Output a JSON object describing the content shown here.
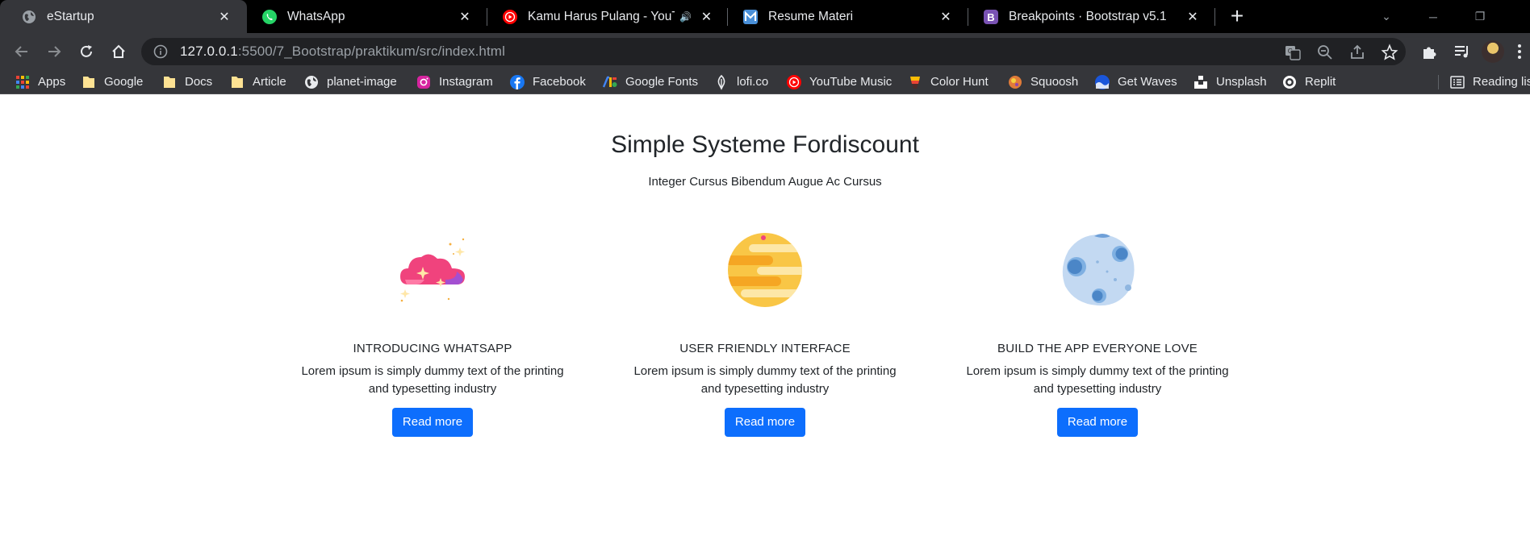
{
  "tabs": [
    {
      "title": "eStartup",
      "icon": "globe-icon",
      "active": true
    },
    {
      "title": "WhatsApp",
      "icon": "whatsapp-icon",
      "active": false
    },
    {
      "title": "Kamu Harus Pulang - YouTube",
      "icon": "youtube-icon",
      "active": false,
      "audio": true
    },
    {
      "title": "Resume Materi",
      "icon": "m-app-icon",
      "active": false
    },
    {
      "title": "Breakpoints · Bootstrap v5.1",
      "icon": "bootstrap-icon",
      "active": false
    }
  ],
  "toolbar": {
    "url_host": "127.0.0.1",
    "url_path": ":5500/7_Bootstrap/praktikum/src/index.html"
  },
  "bookmarks": [
    {
      "label": "Apps",
      "icon": "apps-grid-icon"
    },
    {
      "label": "Google",
      "icon": "folder-icon"
    },
    {
      "label": "Docs",
      "icon": "folder-icon"
    },
    {
      "label": "Article",
      "icon": "folder-icon"
    },
    {
      "label": "planet-image",
      "icon": "globe-icon"
    },
    {
      "label": "Instagram",
      "icon": "instagram-icon"
    },
    {
      "label": "Facebook",
      "icon": "facebook-icon"
    },
    {
      "label": "Google Fonts",
      "icon": "google-fonts-icon"
    },
    {
      "label": "lofi.co",
      "icon": "lofi-icon"
    },
    {
      "label": "YouTube Music",
      "icon": "youtube-music-icon"
    },
    {
      "label": "Color Hunt",
      "icon": "color-hunt-icon"
    },
    {
      "label": "Squoosh",
      "icon": "squoosh-icon"
    },
    {
      "label": "Get Waves",
      "icon": "get-waves-icon"
    },
    {
      "label": "Unsplash",
      "icon": "unsplash-icon"
    },
    {
      "label": "Replit",
      "icon": "replit-icon"
    }
  ],
  "reading_list": "Reading list",
  "hero": {
    "title": "Simple Systeme Fordiscount",
    "subtitle": "Integer Cursus Bibendum Augue Ac Cursus"
  },
  "features": [
    {
      "title": "INTRODUCING WHATSAPP",
      "text": "Lorem ipsum is simply dummy text of the printing and typesetting industry",
      "button": "Read more",
      "icon": "pink-cloud-icon"
    },
    {
      "title": "USER FRIENDLY INTERFACE",
      "text": "Lorem ipsum is simply dummy text of the printing and typesetting industry",
      "button": "Read more",
      "icon": "yellow-planet-icon"
    },
    {
      "title": "BUILD THE APP EVERYONE LOVE",
      "text": "Lorem ipsum is simply dummy text of the printing and typesetting industry",
      "button": "Read more",
      "icon": "blue-moon-icon"
    }
  ],
  "colors": {
    "primary_button": "#0d6efd",
    "tabstrip": "#000000",
    "toolbar": "#35363a"
  }
}
